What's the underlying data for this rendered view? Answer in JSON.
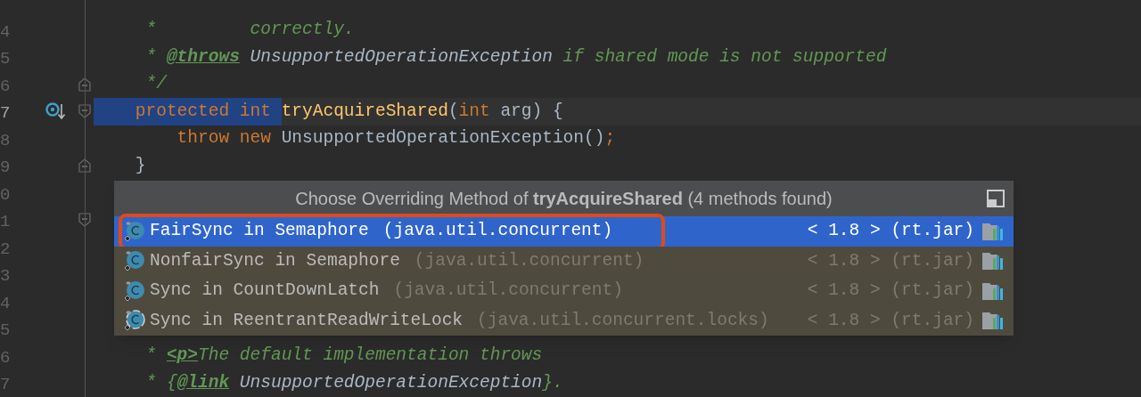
{
  "editor": {
    "lines": [
      {
        "number": "4",
        "tokens": [
          {
            "text": "     *         correctly.",
            "kind": "comment"
          }
        ]
      },
      {
        "number": "5",
        "tokens": [
          {
            "text": "     * ",
            "kind": "comment"
          },
          {
            "text": "@throws",
            "kind": "tag"
          },
          {
            "text": " UnsupportedOperationException",
            "kind": "ref"
          },
          {
            "text": " if shared mode is not supported",
            "kind": "comment"
          }
        ]
      },
      {
        "number": "6",
        "fold_close": true,
        "tokens": [
          {
            "text": "     */",
            "kind": "comment"
          }
        ]
      },
      {
        "number": "7",
        "current": true,
        "override": true,
        "fold_open": true,
        "tokens": [
          {
            "text": "    protected int ",
            "kind": "keyword",
            "selected": true
          },
          {
            "text": "tryAcquireShared",
            "kind": "method",
            "selected": false
          },
          {
            "text": "(",
            "kind": "plain",
            "selected": false
          },
          {
            "text": "int",
            "kind": "keyword",
            "selected": false
          },
          {
            "text": " arg) {",
            "kind": "plain",
            "selected": false
          }
        ]
      },
      {
        "number": "8",
        "tokens": [
          {
            "text": "        throw new ",
            "kind": "keyword"
          },
          {
            "text": "UnsupportedOperationException()",
            "kind": "plain"
          },
          {
            "text": ";",
            "kind": "keyword"
          }
        ]
      },
      {
        "number": "9",
        "fold_close": true,
        "tokens": [
          {
            "text": "    }",
            "kind": "plain"
          }
        ]
      },
      {
        "number": "0"
      },
      {
        "number": "1",
        "fold_open": true
      },
      {
        "number": "2"
      },
      {
        "number": "3"
      },
      {
        "number": "4"
      },
      {
        "number": "5"
      },
      {
        "number": "6",
        "tokens": [
          {
            "text": "     * ",
            "kind": "comment"
          },
          {
            "text": "<p>",
            "kind": "tag"
          },
          {
            "text": "The default implementation throws",
            "kind": "comment"
          }
        ]
      },
      {
        "number": "7",
        "tokens": [
          {
            "text": "     * {",
            "kind": "comment"
          },
          {
            "text": "@link",
            "kind": "tag"
          },
          {
            "text": " UnsupportedOperationException",
            "kind": "ref"
          },
          {
            "text": "}.",
            "kind": "comment"
          }
        ]
      }
    ]
  },
  "popup": {
    "title": "Choose Overriding Method of **tryAcquireShared** (4 methods found)",
    "items": [
      {
        "name": "FairSync in Semaphore",
        "package": "(java.util.concurrent)",
        "location": "< 1.8 > (rt.jar)",
        "selected": true,
        "annotated": true,
        "abstract": false
      },
      {
        "name": "NonfairSync in Semaphore",
        "package": "(java.util.concurrent)",
        "location": "< 1.8 > (rt.jar)",
        "selected": false,
        "annotated": false,
        "abstract": false
      },
      {
        "name": "Sync in CountDownLatch",
        "package": "(java.util.concurrent)",
        "location": "< 1.8 > (rt.jar)",
        "selected": false,
        "annotated": false,
        "abstract": false
      },
      {
        "name": "Sync in ReentrantReadWriteLock",
        "package": "(java.util.concurrent.locks)",
        "location": "< 1.8 > (rt.jar)",
        "selected": false,
        "annotated": false,
        "abstract": true
      }
    ]
  }
}
